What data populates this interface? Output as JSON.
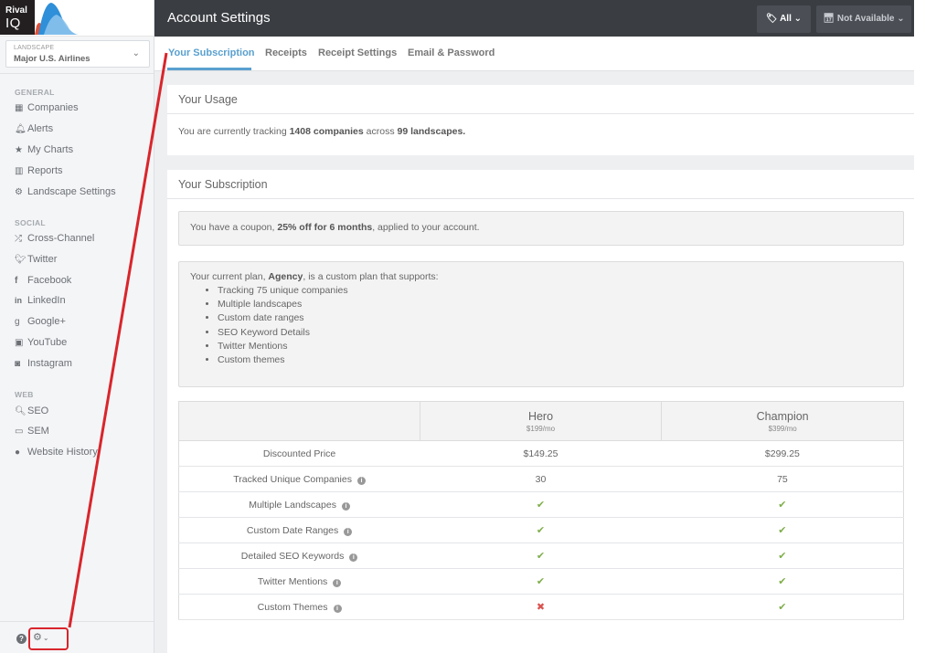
{
  "logo": {
    "line1": "Rival",
    "line2": "IQ"
  },
  "landscape": {
    "label": "LANDSCAPE",
    "value": "Major U.S. Airlines",
    "chevron": "⌄"
  },
  "sidebar": {
    "sections": [
      {
        "title": "GENERAL",
        "items": [
          {
            "icon": "th-icon",
            "glyph": "▦",
            "label": "Companies"
          },
          {
            "icon": "bell-icon",
            "glyph": "🔔︎",
            "label": "Alerts"
          },
          {
            "icon": "star-icon",
            "glyph": "★",
            "label": "My Charts"
          },
          {
            "icon": "bar-chart-icon",
            "glyph": "▥",
            "label": "Reports"
          },
          {
            "icon": "gear-icon",
            "glyph": "⚙",
            "label": "Landscape Settings"
          }
        ]
      },
      {
        "title": "SOCIAL",
        "items": [
          {
            "icon": "random-icon",
            "glyph": "⤮",
            "label": "Cross-Channel"
          },
          {
            "icon": "twitter-icon",
            "glyph": "🐦︎",
            "label": "Twitter"
          },
          {
            "icon": "facebook-icon",
            "glyph": "f",
            "label": "Facebook"
          },
          {
            "icon": "linkedin-icon",
            "glyph": "in",
            "label": "LinkedIn"
          },
          {
            "icon": "google-plus-icon",
            "glyph": "g",
            "label": "Google+"
          },
          {
            "icon": "youtube-icon",
            "glyph": "▣",
            "label": "YouTube"
          },
          {
            "icon": "instagram-icon",
            "glyph": "◙",
            "label": "Instagram"
          }
        ]
      },
      {
        "title": "WEB",
        "items": [
          {
            "icon": "search-icon",
            "glyph": "🔍︎",
            "label": "SEO"
          },
          {
            "icon": "money-icon",
            "glyph": "▭",
            "label": "SEM"
          },
          {
            "icon": "globe-icon",
            "glyph": "●",
            "label": "Website History"
          }
        ]
      }
    ],
    "bottom": {
      "help_glyph": "?",
      "settings_glyph": "⚙",
      "settings_chevron": "⌄"
    }
  },
  "header": {
    "title": "Account Settings",
    "tag_filter": {
      "glyph": "🏷︎",
      "label": "All",
      "chevron": "⌄"
    },
    "date_filter": {
      "glyph": "📅︎",
      "label": "Not Available",
      "chevron": "⌄"
    }
  },
  "tabs": [
    {
      "label": "Your Subscription",
      "active": true
    },
    {
      "label": "Receipts",
      "active": false
    },
    {
      "label": "Receipt Settings",
      "active": false
    },
    {
      "label": "Email & Password",
      "active": false
    }
  ],
  "usage": {
    "title": "Your Usage",
    "prefix": "You are currently tracking ",
    "companies": "1408 companies",
    "middle": " across ",
    "landscapes": "99 landscapes.",
    "suffix": ""
  },
  "subscription": {
    "title": "Your Subscription",
    "coupon": {
      "prefix": "You have a coupon, ",
      "bold": "25% off for 6 months",
      "suffix": ", applied to your account."
    },
    "plan": {
      "prefix": "Your current plan, ",
      "name": "Agency",
      "suffix": ", is a custom plan that supports:",
      "features": [
        "Tracking 75 unique companies",
        "Multiple landscapes",
        "Custom date ranges",
        "SEO Keyword Details",
        "Twitter Mentions",
        "Custom themes"
      ]
    },
    "comparison": {
      "plans": [
        {
          "name": "Hero",
          "price": "$199/mo"
        },
        {
          "name": "Champion",
          "price": "$399/mo"
        }
      ],
      "rows": [
        {
          "label": "Discounted Price",
          "info": false,
          "values": [
            "$149.25",
            "$299.25"
          ]
        },
        {
          "label": "Tracked Unique Companies",
          "info": true,
          "values": [
            "30",
            "75"
          ]
        },
        {
          "label": "Multiple Landscapes",
          "info": true,
          "values": [
            "check",
            "check"
          ]
        },
        {
          "label": "Custom Date Ranges",
          "info": true,
          "values": [
            "check",
            "check"
          ]
        },
        {
          "label": "Detailed SEO Keywords",
          "info": true,
          "values": [
            "check",
            "check"
          ]
        },
        {
          "label": "Twitter Mentions",
          "info": true,
          "values": [
            "check",
            "check"
          ]
        },
        {
          "label": "Custom Themes",
          "info": true,
          "values": [
            "cross",
            "check"
          ]
        }
      ],
      "check_glyph": "✔",
      "cross_glyph": "✖",
      "info_glyph": "i"
    }
  },
  "colors": {
    "accent": "#5aa0cf",
    "header_bg": "#3a3d42",
    "check": "#7fae4a",
    "cross": "#d9534f",
    "annotation": "#d9252b"
  }
}
